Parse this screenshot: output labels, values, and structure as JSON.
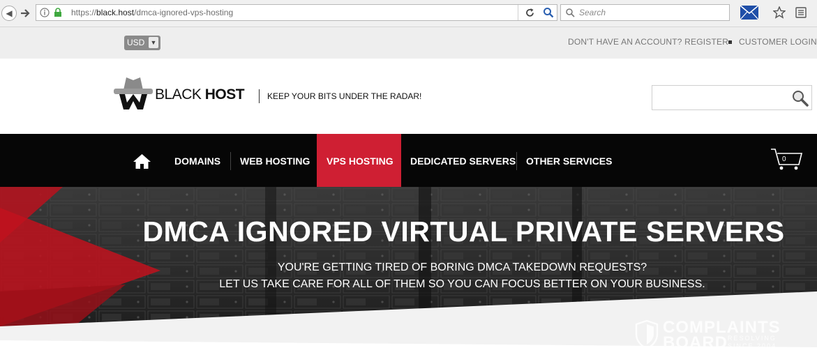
{
  "browser": {
    "url_prefix": "https://",
    "url_domain": "black.host",
    "url_path": "/dmca-ignored-vps-hosting",
    "search_placeholder": "Search"
  },
  "topbar": {
    "currency": "USD",
    "register_link": "DON'T HAVE AN ACCOUNT? REGISTER",
    "login_link": "CUSTOMER LOGIN"
  },
  "header": {
    "brand_bold": "BLACK",
    "brand_light": "HOST",
    "tagline": "KEEP YOUR BITS UNDER THE RADAR!"
  },
  "nav": {
    "items": [
      {
        "label": "DOMAINS"
      },
      {
        "label": "WEB HOSTING"
      },
      {
        "label": "VPS HOSTING"
      },
      {
        "label": "DEDICATED SERVERS"
      },
      {
        "label": "OTHER SERVICES"
      }
    ],
    "cart_count": "0",
    "active_color": "#cf1f33"
  },
  "hero": {
    "title": "DMCA IGNORED VIRTUAL PRIVATE SERVERS",
    "subtitle_line1": "YOU'RE GETTING TIRED OF BORING DMCA TAKEDOWN REQUESTS?",
    "subtitle_line2": "LET US TAKE CARE FOR ALL OF THEM SO YOU CAN FOCUS BETTER ON YOUR BUSINESS."
  },
  "watermark": {
    "line1": "COMPLAINTS",
    "line2": "BOARD",
    "tag1": "RESOLVING",
    "tag2": "SINCE 2004"
  }
}
